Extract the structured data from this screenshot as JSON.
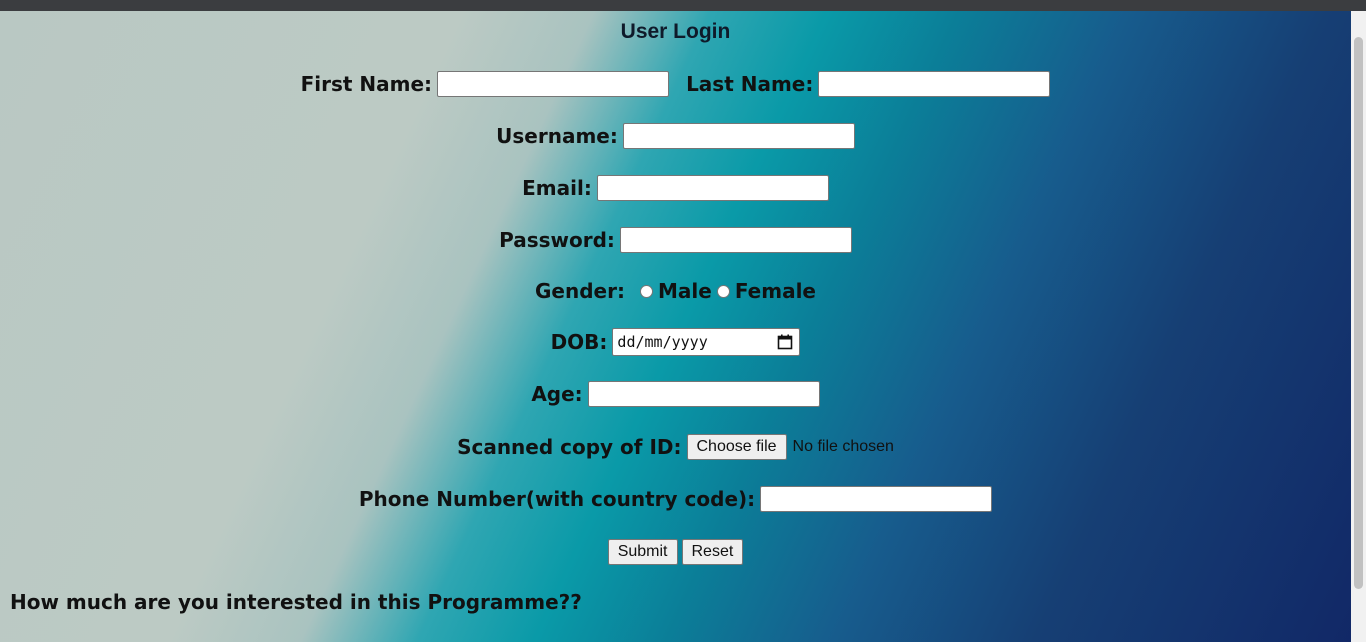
{
  "page": {
    "title": "User Login"
  },
  "form": {
    "first_name_label": "First Name:",
    "last_name_label": "Last Name:",
    "username_label": "Username:",
    "email_label": "Email:",
    "password_label": "Password:",
    "gender_label": "Gender:",
    "gender_options": [
      "Male",
      "Female"
    ],
    "dob_label": "DOB:",
    "dob_placeholder": "dd/mm/yyyy",
    "age_label": "Age:",
    "id_label": "Scanned copy of ID:",
    "choose_file_label": "Choose file",
    "no_file_text": "No file chosen",
    "phone_label": "Phone Number(with country code):",
    "submit_label": "Submit",
    "reset_label": "Reset"
  },
  "question": "How much are you interested in this Programme??"
}
